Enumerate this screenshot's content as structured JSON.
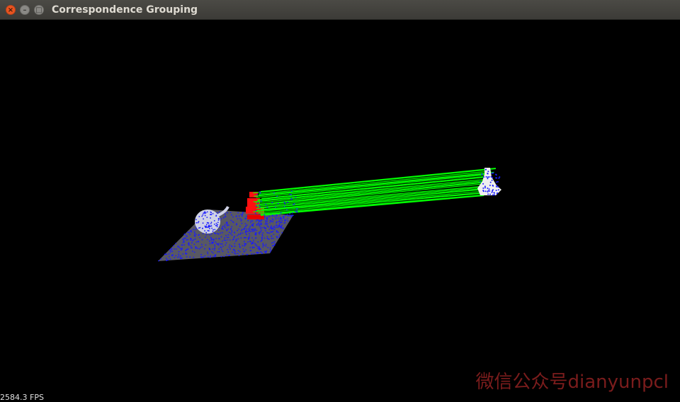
{
  "window": {
    "title": "Correspondence Grouping",
    "controls": {
      "close_icon": "close-icon",
      "minimize_icon": "minimize-icon",
      "maximize_icon": "maximize-icon"
    }
  },
  "viewer": {
    "background": "#000000",
    "fps_text": "2584.3 FPS",
    "watermark_text": "微信公众号dianyunpcl",
    "colors": {
      "scene_points": "#1a1aff",
      "scene_plane": "#6c6c78",
      "model_points": "#ff1a1a",
      "matched_instance": "#eeeeee",
      "correspondence_lines": "#00ff00"
    }
  }
}
